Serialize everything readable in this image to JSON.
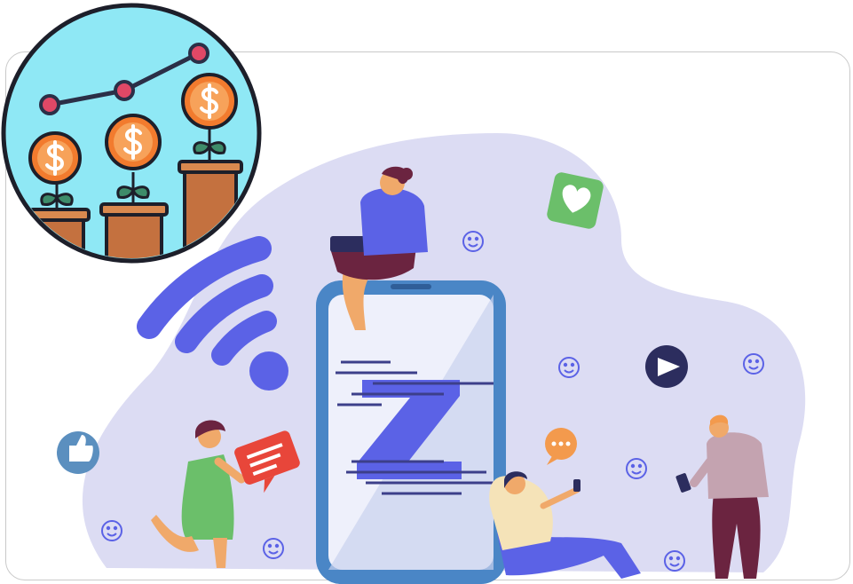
{
  "colors": {
    "blob": "#dcdcf3",
    "primary_blue": "#5b62e6",
    "navy": "#2c2d5e",
    "phone_frame": "#4a86c6",
    "phone_screen": "#eef0fb",
    "badge_circle_bg": "#8fe8f5",
    "coin_orange": "#f27b2e",
    "pot_brown": "#c4713f",
    "leaf_green": "#3e8c6a",
    "chart_line": "#2b2f47",
    "chart_dot": "#e04866",
    "heart_tile": "#6bbf6a",
    "bubble_red": "#e8463a",
    "bubble_orange": "#f39a4d",
    "thumb_blue": "#5b8fbf"
  },
  "icons": [
    "growth-chart-badge-icon",
    "dollar-coin-icon",
    "wifi-signal-icon",
    "heart-tile-icon",
    "play-button-icon",
    "thumbs-up-icon",
    "chat-bubble-icon",
    "typing-bubble-icon",
    "smiley-icon",
    "z-logo-icon"
  ]
}
